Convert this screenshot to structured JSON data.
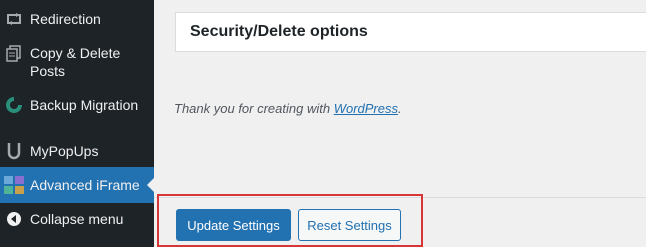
{
  "sidebar": {
    "items": [
      {
        "label": "Redirection",
        "icon": "redirect-icon"
      },
      {
        "label": "Copy & Delete Posts",
        "icon": "copy-icon"
      },
      {
        "label": "Backup Migration",
        "icon": "backup-icon"
      },
      {
        "label": "MyPopUps",
        "icon": "popup-icon"
      },
      {
        "label": "Advanced iFrame",
        "icon": "iframe-icon",
        "active": true
      },
      {
        "label": "Collapse menu",
        "icon": "collapse-icon"
      }
    ]
  },
  "main": {
    "section_title": "Security/Delete options",
    "footer_prefix": "Thank you for creating with ",
    "footer_link": "WordPress",
    "footer_suffix": "."
  },
  "actions": {
    "update_label": "Update Settings",
    "reset_label": "Reset Settings"
  },
  "colors": {
    "sidebar_bg": "#1d2327",
    "accent": "#2271b1",
    "highlight": "#d63638"
  }
}
